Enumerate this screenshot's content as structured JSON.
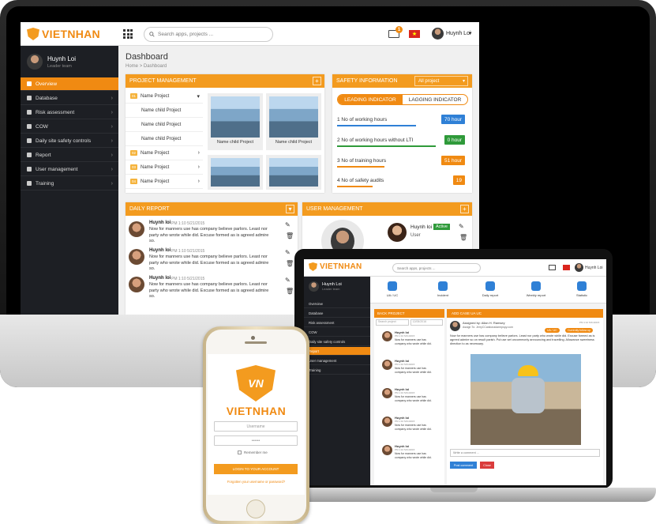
{
  "brand": {
    "name": "VIETNHAN",
    "accent": "#f08a12"
  },
  "desktop": {
    "search_placeholder": "Search apps, projects ...",
    "mail_count": "1",
    "user_name": "Huynh Loi",
    "sidebar_user": {
      "name": "Huynh Loi",
      "role": "Leader team"
    },
    "sidebar_items": [
      "Overview",
      "Database",
      "Risk assessment",
      "COW",
      "Daily site safety controls",
      "Report",
      "User management",
      "Training"
    ],
    "page_title": "Dashboard",
    "breadcrumb": {
      "home": "Home",
      "sep": ">",
      "current": "Dashboard"
    },
    "project_panel": {
      "title": "PROJECT MANAGEMENT",
      "rows": [
        {
          "num": "01",
          "label": "Name Project"
        },
        {
          "num": "",
          "label": "Name child Project"
        },
        {
          "num": "",
          "label": "Name child Project"
        },
        {
          "num": "",
          "label": "Name child Project"
        },
        {
          "num": "02",
          "label": "Name Project"
        },
        {
          "num": "03",
          "label": "Name Project"
        },
        {
          "num": "04",
          "label": "Name Project"
        }
      ],
      "tiles": [
        "Name child Project",
        "Name child Project"
      ]
    },
    "safety_panel": {
      "title": "SAFETY INFORMATION",
      "select": "All project",
      "tabs": [
        "LEADING INDICATOR",
        "LAGGING INDICATOR"
      ],
      "indicators": [
        {
          "label": "1 No of working hours",
          "value": "70 hour",
          "color": "#2f80d6"
        },
        {
          "label": "2 No of working hours without LTI",
          "value": "0 hour",
          "color": "#2f9a3a"
        },
        {
          "label": "3 No of training hours",
          "value": "51 hour",
          "color": "#f08a12"
        },
        {
          "label": "4 No of safety audits",
          "value": "19",
          "color": "#f08a12"
        }
      ]
    },
    "daily_report": {
      "title": "DAILY REPORT",
      "items": [
        {
          "name": "Huynh loi",
          "time": "PM 1:10 5/21/2015",
          "text": "Now for manners use has company believe parlors. Least nor party who wrote while did. Excuse formed as is agreed admire so."
        },
        {
          "name": "Huynh loi",
          "time": "PM 1:10 5/21/2015",
          "text": "Now for manners use has company believe parlors. Least nor party who wrote while did. Excuse formed as is agreed admire so."
        },
        {
          "name": "Huynh loi",
          "time": "PM 1:10 5/21/2015",
          "text": "Now for manners use has company believe parlors. Least nor party who wrote while did. Excuse formed as is agreed admire so."
        }
      ]
    },
    "user_panel": {
      "title": "USER MANAGEMENT",
      "user": {
        "name": "Huynh loi",
        "status": "Active",
        "role": "User"
      }
    }
  },
  "laptop": {
    "search_placeholder": "Search apps, projects ...",
    "user_name": "Huynh Loi",
    "sidebar_user": {
      "name": "Huynh Loi",
      "role": "Leader team"
    },
    "sidebar_items": [
      "Overview",
      "Database",
      "Risk assessment",
      "COW",
      "Daily site safety controls",
      "Report",
      "User management",
      "Training"
    ],
    "nav": [
      "UA / UC",
      "Incident",
      "Daily report",
      "Weekly report",
      "Statistic"
    ],
    "list_header": {
      "back": "BACK PROJECT",
      "search": "Search project",
      "date": "12/05/2016"
    },
    "list_items": [
      {
        "name": "Huynh loi",
        "time": "PM 1:10 5/21/2015",
        "text": "Now for manners use has company who wrote while did."
      },
      {
        "name": "Huynh loi",
        "time": "PM 1:10 5/21/2015",
        "text": "Now for manners use has company who wrote while did."
      },
      {
        "name": "Huynh loi",
        "time": "PM 1:10 5/21/2015",
        "text": "Now for manners use has company who wrote while did."
      },
      {
        "name": "Huynh loi",
        "time": "PM 1:10 5/21/2015",
        "text": "Now for manners use has company who wrote while did."
      },
      {
        "name": "Huynh loi",
        "time": "PM 1:10 5/21/2015",
        "text": "Now for manners use has company who wrote while did."
      }
    ],
    "detail": {
      "add_button": "ADD CASE UA UC",
      "assigned": "Assigned by: Allan H. Ramsey",
      "assign_to": "Assign To: JerryCCastionadarmpspy.com",
      "date": "PM 1:10 5/21/2015",
      "tags": [
        "UA / UC",
        "Currently follow up"
      ],
      "text": "Now for manners use has company believe parlors. Least nor party who wrote while did. Excuse formed as is agreed admire so on result parish. Put use set uncommonly announcing and travelling. Allowance sweetness direction to as necessary.",
      "comment_placeholder": "Write a comment ...",
      "post_label": "Post comment",
      "close_label": "Close"
    }
  },
  "phone": {
    "brand": "VIETNHAN",
    "username_placeholder": "Username",
    "password_value": "••••••",
    "remember": "Remember me",
    "login": "LOGIN TO YOUR ACCOUNT",
    "forgot": "Forgotten your username or password?"
  }
}
